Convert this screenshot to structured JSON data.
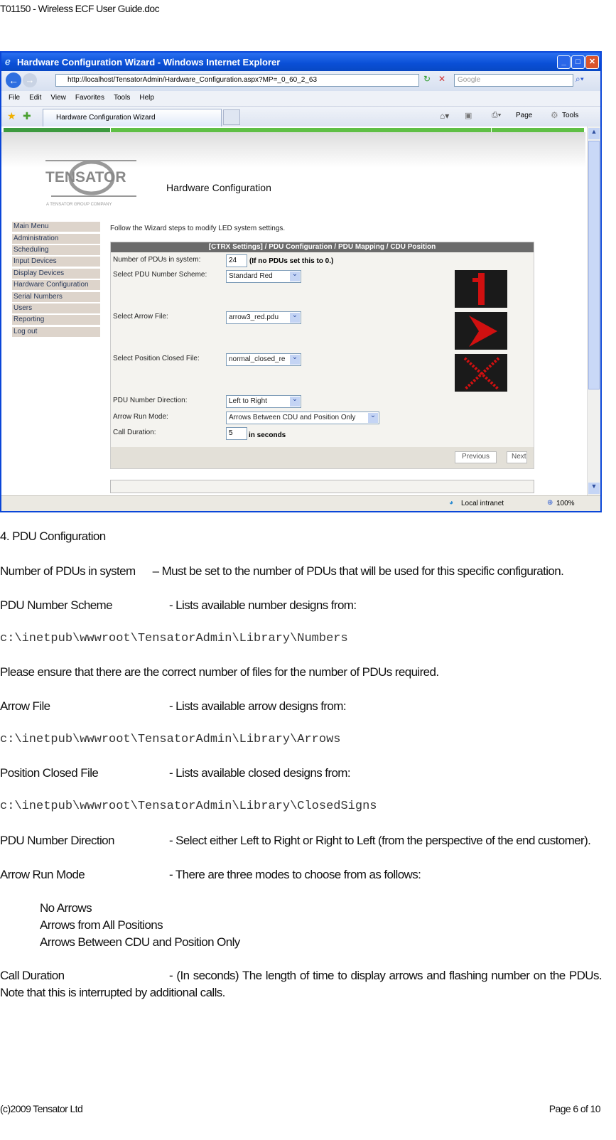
{
  "doc_header": "T01150 - Wireless ECF User Guide.doc",
  "browser": {
    "title": "Hardware Configuration Wizard - Windows Internet Explorer",
    "url": "http://localhost/TensatorAdmin/Hardware_Configuration.aspx?MP=_0_60_2_63",
    "search_placeholder": "Google",
    "menu": [
      "File",
      "Edit",
      "View",
      "Favorites",
      "Tools",
      "Help"
    ],
    "tab": "Hardware Configuration Wizard",
    "toolbar": {
      "page": "Page",
      "tools": "Tools"
    },
    "status": {
      "zone": "Local intranet",
      "zoom": "100%"
    }
  },
  "page": {
    "logo": "TENSATOR",
    "logo_tagline": "A TENSATOR GROUP COMPANY",
    "heading": "Hardware Configuration",
    "intro": "Follow the Wizard steps to modify LED system settings.",
    "sidebar": [
      "Main Menu",
      "Administration",
      "Scheduling",
      "Input Devices",
      "Display Devices",
      "Hardware Configuration",
      "Serial Numbers",
      "Users",
      "Reporting",
      "Log out"
    ],
    "panel_title": "[CTRX Settings] / PDU Configuration / PDU Mapping / CDU Position",
    "fields": {
      "num_pdus_label": "Number of PDUs in system:",
      "num_pdus": "24",
      "num_pdus_hint": "(If no PDUs set this to 0.)",
      "scheme_label": "Select PDU Number Scheme:",
      "scheme": "Standard Red",
      "arrow_label": "Select Arrow File:",
      "arrow": "arrow3_red.pdu",
      "closed_label": "Select Position Closed File:",
      "closed": "normal_closed_re",
      "direction_label": "PDU Number Direction:",
      "direction": "Left to Right",
      "runmode_label": "Arrow Run Mode:",
      "runmode": "Arrows Between CDU and Position Only",
      "duration_label": "Call Duration:",
      "duration": "5",
      "duration_unit": "in seconds"
    },
    "previous": "Previous",
    "next": "Next",
    "led_colors": {
      "bg": "#1a1a1a",
      "led": "#d01010"
    }
  },
  "body": {
    "section": "4. PDU Configuration",
    "num_label": "Number of PDUs in system",
    "num_desc": "– Must be set to the number of PDUs that will be used for this specific configuration.",
    "scheme_label": "PDU Number Scheme",
    "scheme_desc": "- Lists available number designs from:",
    "scheme_path": "c:\\inetpub\\wwwroot\\TensatorAdmin\\Library\\Numbers",
    "ensure": "Please ensure that there are the correct number of files for the number of PDUs required.",
    "arrow_label": "Arrow File",
    "arrow_desc": "- Lists available arrow designs from:",
    "arrow_path": "c:\\inetpub\\wwwroot\\TensatorAdmin\\Library\\Arrows",
    "closed_label": "Position Closed File",
    "closed_desc": "- Lists available closed designs from:",
    "closed_path": "c:\\inetpub\\wwwroot\\TensatorAdmin\\Library\\ClosedSigns",
    "dir_label": "PDU Number Direction",
    "dir_desc": "- Select either Left to Right or Right to Left (from the perspective of the end customer).",
    "mode_label": "Arrow Run Mode",
    "mode_desc": "- There are three modes to choose from as follows:",
    "modes": [
      "No Arrows",
      "Arrows from All Positions",
      "Arrows Between CDU and Position Only"
    ],
    "dur_label": "Call Duration",
    "dur_desc": "- (In seconds) The length of time to display arrows and flashing number on the PDUs.  Note that this is interrupted by additional calls."
  },
  "footer": {
    "left": "(c)2009 Tensator Ltd",
    "right": "Page 6 of 10"
  }
}
